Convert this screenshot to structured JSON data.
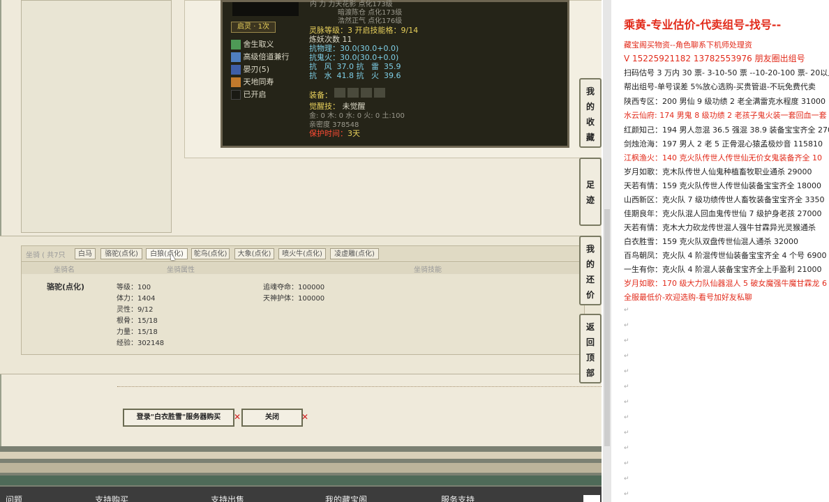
{
  "character": {
    "stat_lines_top": [
      "内  力  力天花影  点化173级",
      "暗渡陈仓  点化173级",
      "浩然正气  点化176级"
    ],
    "spirit_label": "启灵 · 1次",
    "skills": [
      {
        "icon": "sacrifice-icon",
        "label": "舍生取义"
      },
      {
        "icon": "double-speed-icon",
        "label": "高级倍道兼行"
      },
      {
        "icon": "blade-icon",
        "label": "晏刃(5)"
      },
      {
        "icon": "heaven-earth-icon",
        "label": "天地同寿"
      },
      {
        "icon": "empty-slot-icon",
        "label": "已开启"
      }
    ],
    "stats": [
      {
        "text": "灵脉等级：3  开启技能格：9/14",
        "color": "yellow"
      },
      {
        "text": "炼妖次数 11",
        "color": "white"
      },
      {
        "text": "抗物理：30.0(30.0+0.0)",
        "color": "cyan"
      },
      {
        "text": "抗鬼火：30.0(30.0+0.0)",
        "color": "cyan"
      },
      {
        "text": "抗   风  37.0 抗   雷  35.9",
        "color": "cyan"
      },
      {
        "text": "抗   水  41.8 抗   火  39.6",
        "color": "cyan"
      }
    ],
    "equip_label": "装备：",
    "awaken_label": "觉醒技：",
    "awaken_value": "未觉醒",
    "elements": "金: 0 木: 0 水: 0 火: 0 土:100",
    "intimacy": "亲密度 378548",
    "protect_label": "保护时间：",
    "protect_value": "3天"
  },
  "mount": {
    "title": "坐骑 ( 共7只",
    "tabs": [
      "白马",
      "骆驼(点化)",
      "白狼(点化)",
      "鸵鸟(点化)",
      "大象(点化)",
      "喷火牛(点化)",
      "凌虚雕(点化)"
    ],
    "active_tab": 2,
    "col_headers": [
      "坐骑名",
      "坐骑属性",
      "坐骑技能"
    ],
    "name": "骆驼(点化)",
    "attributes": [
      "等级：100",
      "体力：1404",
      "灵性：9/12",
      "根骨：15/18",
      "力量：15/18",
      "经验：302148"
    ],
    "skills": [
      "追魂夺命：100000",
      "天神护体：100000"
    ]
  },
  "buttons": {
    "login_buy": "登录\"白衣胜雪\"服务器购买",
    "close": "关闭"
  },
  "side_tabs": [
    "我的收藏",
    "足迹",
    "我的还价",
    "返回顶部"
  ],
  "footer_nav": [
    "问题",
    "支持购买",
    "支持出售",
    "我的藏宝阁",
    "服务支持"
  ],
  "doc": {
    "title": "乘黄-专业估价-代卖组号-找号--",
    "lines": [
      {
        "text": "藏宝阁买物资--角色聊系下机师处理资",
        "red": true
      },
      {
        "text": "V 15225921182    13782553976 朋友圈出组号",
        "red": true
      },
      {
        "text": "扫码估号 3 万内 30 票- 3-10-50 票  --10-20-100 票- 20以上 1",
        "red": false
      },
      {
        "text": "帮出组号-单号误差 5%放心选购-买贵管退-不玩免费代卖",
        "red": false
      },
      {
        "text": "陕西专区：200 男仙 9 级功绩 2 老全满雷克水程度 31000",
        "red": false
      },
      {
        "text": "水云仙府: 174 男鬼 8 级功绩 2 老孩子鬼火装一套回血一套",
        "red": true
      },
      {
        "text": "红颜知己：194 男人忽混 36.5 强混 38.9 装备宝宝齐全 2700",
        "red": false
      },
      {
        "text": "剑烛沧海：197 男人 2 老 5 正骨混心猿孟极炒音 115810",
        "red": false
      },
      {
        "text": "江枫渔火：140 克火队传世人传世仙无价女鬼装备齐全 10",
        "red": true
      },
      {
        "text": "岁月如歌：克木队传世人仙鬼种植畜牧职业通杀 29000",
        "red": false
      },
      {
        "text": "天若有情：159 克火队传世人传世仙装备宝宝齐全 18000",
        "red": false
      },
      {
        "text": "山西新区：克火队 7 级功绩传世人畜牧装备宝宝齐全 3350",
        "red": false
      },
      {
        "text": "佳期良年：克火队混人回血鬼传世仙 7 级护身老孩 27000",
        "red": false
      },
      {
        "text": "天若有情：克木大力砍龙传世混人强牛甘霖异光灵猴通杀",
        "red": false
      },
      {
        "text": "白衣胜雪：159 克火队双盘传世仙混人通杀 32000",
        "red": false
      },
      {
        "text": "百鸟朝凤：克火队 4 阶混传世仙装备宝宝齐全 4 个号 6900",
        "red": false
      },
      {
        "text": "一生有你：克火队 4 阶混人装备宝宝齐全上手盈利 21000",
        "red": false
      },
      {
        "text": "岁月如歌：170 级大力队仙器混人 5 破女魔强牛魔甘霖龙 6",
        "red": true
      },
      {
        "text": "全服最低价-欢迎选购-看号加好友私聊",
        "red": true
      }
    ]
  },
  "colors": {
    "doc_red": "#e22a1a",
    "panel_dark": "#252418",
    "stat_yellow": "#e9d15b",
    "stat_cyan": "#7fd0e8"
  }
}
